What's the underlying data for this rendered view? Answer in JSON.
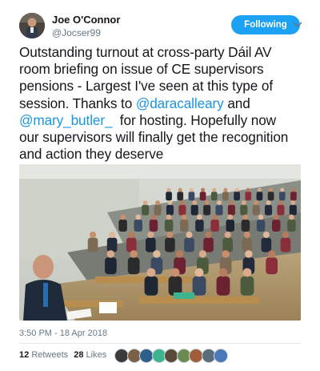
{
  "author": {
    "name": "Joe O'Connor",
    "handle": "@Jocser99"
  },
  "follow_button_label": "Following",
  "tweet": {
    "lines": [
      [
        {
          "t": "Outstanding turnout at cross-party Dáil AV"
        }
      ],
      [
        {
          "t": "room briefing on issue of CE supervisors"
        }
      ],
      [
        {
          "t": "pensions - Largest I've seen at this type of"
        }
      ],
      [
        {
          "t": "session. Thanks to "
        },
        {
          "t": "@daracalleary",
          "mention": true
        },
        {
          "t": " and"
        }
      ],
      [
        {
          "t": "@mary_butler_",
          "mention": true
        },
        {
          "t": "  for hosting. Hopefully now"
        }
      ],
      [
        {
          "t": "our supervisors will finally get the recognition"
        }
      ],
      [
        {
          "t": "and action they deserve"
        }
      ]
    ]
  },
  "timestamp": "3:50 PM - 18 Apr 2018",
  "stats": {
    "retweets_count": "12",
    "retweets_label": "Retweets",
    "likes_count": "28",
    "likes_label": "Likes"
  },
  "liker_avatars": [
    "#3b3b3b",
    "#7a6047",
    "#2c5f8a",
    "#3db38e",
    "#5a4a3a",
    "#6b8a4f",
    "#a05c3b",
    "#5a6b7a",
    "#4a78b8"
  ]
}
